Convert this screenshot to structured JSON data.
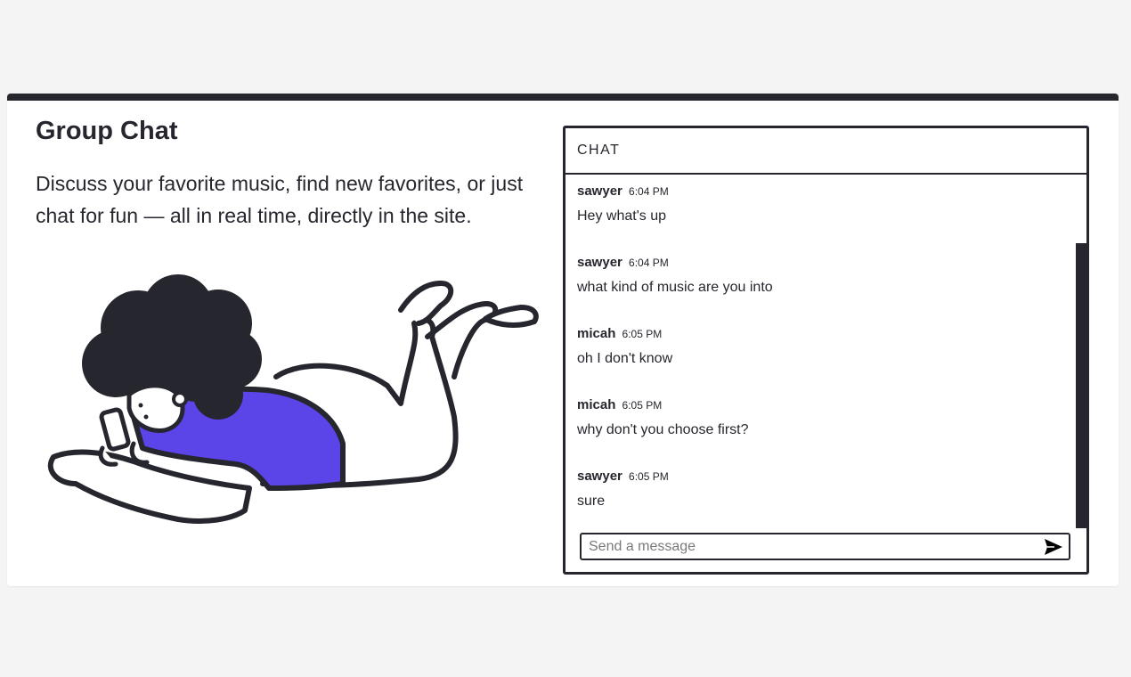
{
  "page": {
    "title": "Group Chat",
    "description": "Discuss your favorite music, find new favorites, or just chat for fun — all in real time, directly in the site."
  },
  "chat": {
    "header": "CHAT",
    "messages": [
      {
        "user": "sawyer",
        "time": "6:04 PM",
        "text": "Hey what's up"
      },
      {
        "user": "sawyer",
        "time": "6:04 PM",
        "text": "what kind of music are you into"
      },
      {
        "user": "micah",
        "time": "6:05 PM",
        "text": "oh I don't know"
      },
      {
        "user": "micah",
        "time": "6:05 PM",
        "text": "why don't you choose first?"
      },
      {
        "user": "sawyer",
        "time": "6:05 PM",
        "text": "sure"
      }
    ],
    "input_placeholder": "Send a message",
    "send_icon": "send-icon"
  },
  "colors": {
    "dark": "#26262e",
    "accent": "#5b44e8",
    "background": "#f4f4f4"
  }
}
